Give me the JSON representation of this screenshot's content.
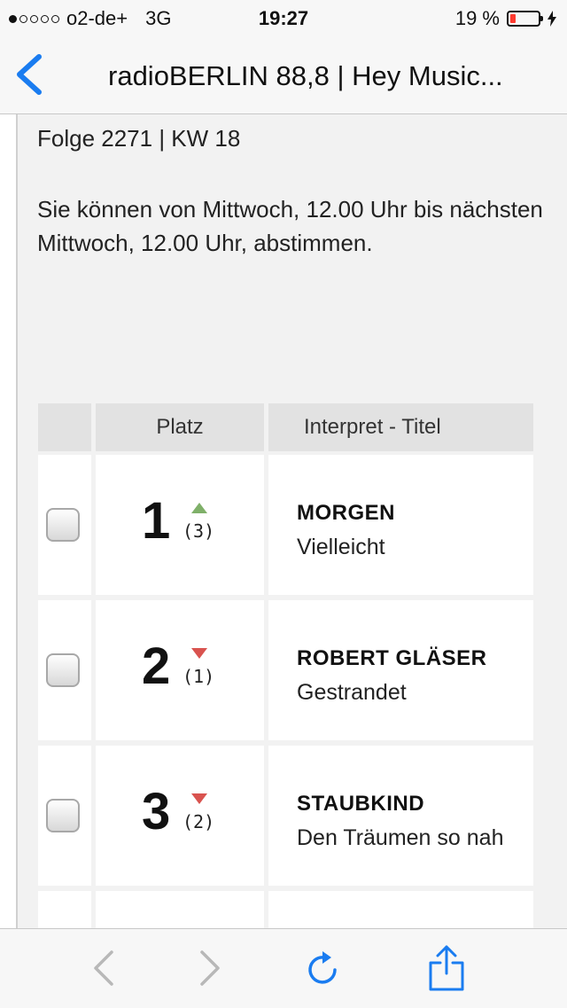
{
  "status_bar": {
    "carrier": "o2-de+",
    "network": "3G",
    "time": "19:27",
    "battery_percent": "19 %",
    "battery_level": 0.19,
    "signal_bars_filled": 1,
    "signal_bars_total": 5
  },
  "nav": {
    "title": "radioBERLIN 88,8 | Hey Music..."
  },
  "page": {
    "episode": "Folge 2271 | KW 18",
    "voting_info": "Sie können von Mittwoch, 12.00 Uhr bis nächsten Mittwoch, 12.00 Uhr, abstimmen."
  },
  "table": {
    "headers": {
      "select": "",
      "rank": "Platz",
      "track": "Interpret - Titel"
    },
    "rows": [
      {
        "rank": "1",
        "trend": "up",
        "previous": "(3)",
        "artist": "MORGEN",
        "title": "Vielleicht"
      },
      {
        "rank": "2",
        "trend": "down",
        "previous": "(1)",
        "artist": "ROBERT GLÄSER",
        "title": "Gestrandet"
      },
      {
        "rank": "3",
        "trend": "down",
        "previous": "(2)",
        "artist": "STAUBKIND",
        "title": "Den Träumen so nah"
      }
    ]
  },
  "colors": {
    "accent": "#1a7cf0",
    "trend_up": "#7fb069",
    "trend_down": "#d9534f",
    "battery_low": "#ff3b30"
  },
  "icons": {
    "back": "chevron-left-icon",
    "browser_back": "chevron-left-icon",
    "browser_forward": "chevron-right-icon",
    "reload": "reload-icon",
    "share": "share-icon"
  }
}
